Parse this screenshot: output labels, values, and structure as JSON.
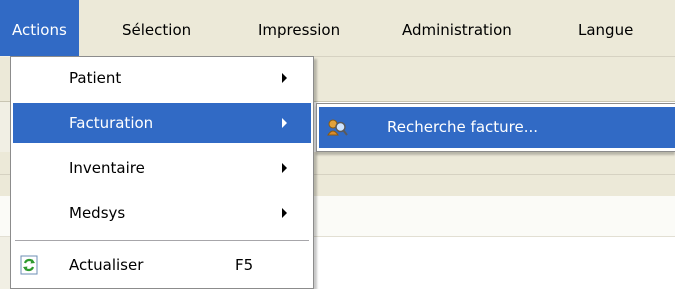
{
  "menubar": {
    "items": [
      "Actions",
      "Sélection",
      "Impression",
      "Administration",
      "Langue"
    ],
    "active": "Actions"
  },
  "actions_menu": {
    "items": [
      {
        "label": "Patient",
        "has_submenu": true
      },
      {
        "label": "Facturation",
        "has_submenu": true,
        "highlighted": true
      },
      {
        "label": "Inventaire",
        "has_submenu": true
      },
      {
        "label": "Medsys",
        "has_submenu": true
      },
      {
        "label": "Actualiser",
        "shortcut": "F5",
        "icon": "refresh-icon"
      }
    ]
  },
  "facturation_submenu": {
    "items": [
      {
        "label": "Recherche facture...",
        "icon": "search-invoice-icon",
        "highlighted": true
      }
    ]
  },
  "colors": {
    "highlight": "#316ac5",
    "menubar_bg": "#ece9d8"
  }
}
